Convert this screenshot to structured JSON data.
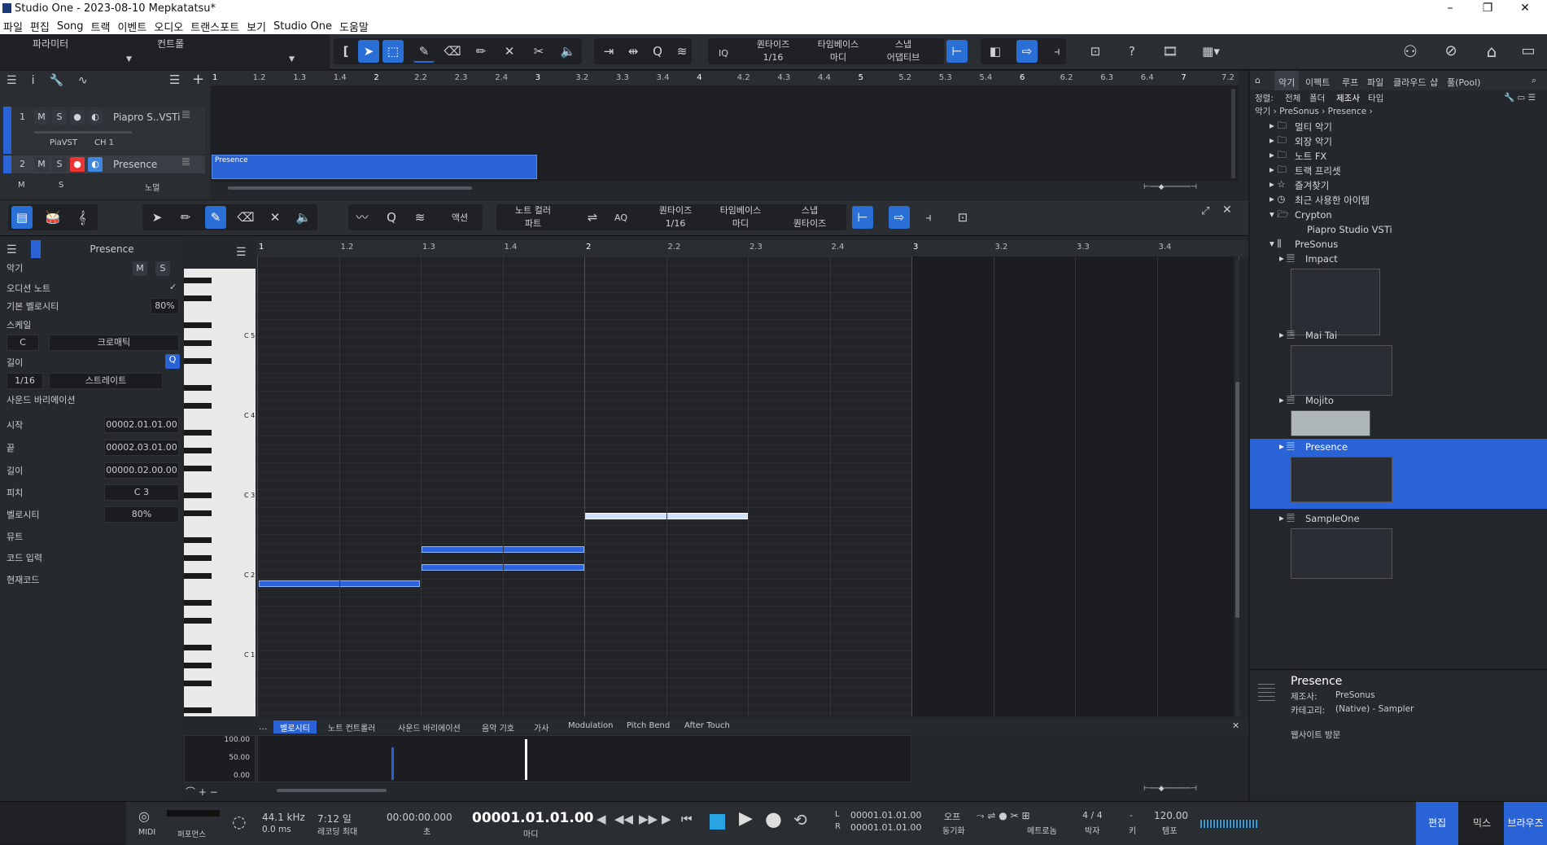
{
  "window": {
    "title": "Studio One - 2023-08-10 Mepkatatsu*"
  },
  "menu": [
    "파일",
    "편집",
    "Song",
    "트랙",
    "이벤트",
    "오디오",
    "트랜스포트",
    "보기",
    "Studio One",
    "도움말"
  ],
  "top_toolbar": {
    "tab_params": "파라미터",
    "tab_controls": "컨트롤",
    "quantize_label": "퀀타이즈",
    "quantize_value": "1/16",
    "timebase_label": "타임베이스",
    "timebase_value": "마디",
    "snap_label": "스냅",
    "snap_value": "어댑티브",
    "iq_label": "IQ",
    "help": "?"
  },
  "arrange": {
    "tracks": [
      {
        "num": "1",
        "name": "Piapro S..VSTi",
        "plugin": "PiaVST",
        "channel": "CH 1"
      },
      {
        "num": "2",
        "name": "Presence"
      }
    ],
    "event_label": "Presence",
    "mode_label": "노멀",
    "ruler": [
      "1",
      "1.2",
      "1.3",
      "1.4",
      "2",
      "2.2",
      "2.3",
      "2.4",
      "3",
      "3.2",
      "3.3",
      "3.4",
      "4",
      "4.2",
      "4.3",
      "4.4",
      "5",
      "5.2",
      "5.3",
      "5.4",
      "6",
      "6.2",
      "6.3",
      "6.4",
      "7",
      "7.2"
    ]
  },
  "editor": {
    "action_label": "액션",
    "note_color_label": "노트 컬러",
    "note_color_value": "파트",
    "quantize_label": "퀀타이즈",
    "quantize_value": "1/16",
    "timebase_label": "타임베이스",
    "timebase_value": "마디",
    "snap_label": "스냅",
    "snap_value": "퀀타이즈",
    "aq_label": "AQ",
    "ruler": [
      "1",
      "1.2",
      "1.3",
      "1.4",
      "2",
      "2.2",
      "2.3",
      "2.4",
      "3",
      "3.2",
      "3.3",
      "3.4"
    ],
    "octaves": [
      "C 5",
      "C 4",
      "C 3",
      "C 2",
      "C 1"
    ]
  },
  "inspector": {
    "track": "Presence",
    "instrument": "악기",
    "audition": "오디션 노트",
    "base_velocity_label": "기본 벨로시티",
    "base_velocity": "80%",
    "scale_label": "스케일",
    "key": "C",
    "scale": "크로매틱",
    "length_label": "길이",
    "length_value": "1/16",
    "length_mode": "스트레이트",
    "sound_var": "사운드 바리에이션",
    "start_label": "시작",
    "start": "00002.01.01.00",
    "end_label": "끝",
    "end": "00002.03.01.00",
    "len_label": "길이",
    "len": "00000.02.00.00",
    "pitch_label": "피치",
    "pitch": "C 3",
    "velocity_label": "벨로시티",
    "velocity": "80%",
    "mute_label": "뮤트",
    "chord_input_label": "코드 입력",
    "current_chord_label": "현재코드",
    "m": "M",
    "s": "S"
  },
  "lanes": {
    "tabs": [
      "벨로시티",
      "노트 컨트롤러",
      "사운드 바리에이션",
      "음악 기호",
      "가사",
      "Modulation",
      "Pitch Bend",
      "After Touch"
    ],
    "dots": "...",
    "scale": [
      "100.00",
      "50.00",
      "0.00"
    ],
    "velocity_pct": [
      0.8,
      1.0
    ]
  },
  "browser": {
    "tabs": [
      "악기",
      "이펙트",
      "루프",
      "파일",
      "클라우드",
      "샵",
      "풀(Pool)"
    ],
    "sort_label": "정렬:",
    "sort_opts": [
      "전체",
      "폴더",
      "제조사",
      "타입"
    ],
    "path": [
      "악기",
      "PreSonus",
      "Presence"
    ],
    "items": [
      "멀티 악기",
      "외장 악기",
      "노트 FX",
      "트랙 프리셋",
      "즐겨찾기",
      "최근 사용한 아이템",
      "Crypton",
      "Piapro Studio VSTi",
      "PreSonus",
      "Impact",
      "Mai Tai",
      "Mojito",
      "Presence",
      "SampleOne"
    ],
    "info_title": "Presence",
    "info_maker_label": "제조사:",
    "info_maker": "PreSonus",
    "info_cat_label": "카테고리:",
    "info_cat": "(Native) - Sampler",
    "website": "웹사이트 방문"
  },
  "transport": {
    "midi": "MIDI",
    "perf": "퍼포먼스",
    "rate": "44.1 kHz",
    "latency": "0.0 ms",
    "rec_time": "7:12 일",
    "rec_max": "레코딩 최대",
    "time_sec": "00:00:00.000",
    "time_sec_unit": "초",
    "time_bars": "00001.01.01.00",
    "time_bars_unit": "마디",
    "loop_l": "00001.01.01.00",
    "loop_r": "00001.01.01.00",
    "sync_off": "오프",
    "sync_label": "동기화",
    "metronome": "메트로놈",
    "sig": "4 / 4",
    "sig_label": "박자",
    "key_val": "-",
    "key_label": "키",
    "tempo": "120.00",
    "tempo_label": "템포",
    "btn_edit": "편집",
    "btn_mix": "믹스",
    "btn_browse": "브라우즈"
  }
}
